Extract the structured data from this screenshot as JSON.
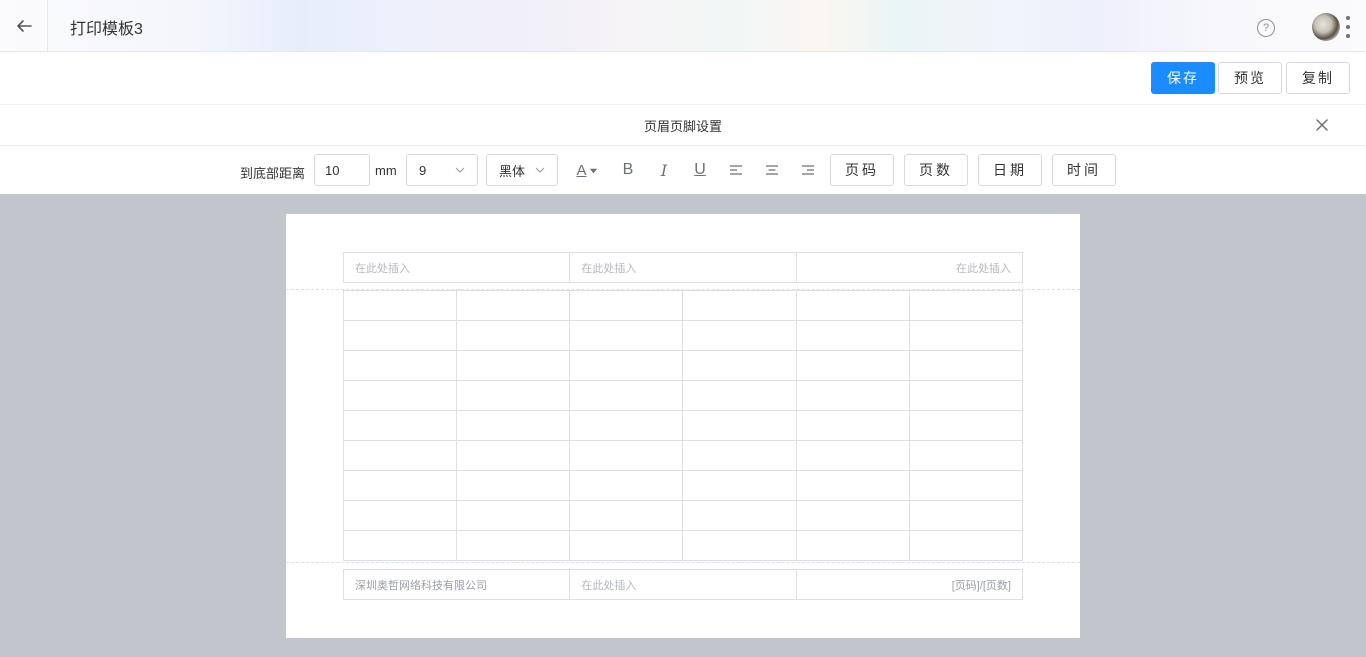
{
  "header": {
    "title": "打印模板3",
    "help_glyph": "?",
    "icons": [
      "arrow-left-icon",
      "help-circle-icon",
      "more-vertical-icon"
    ]
  },
  "actions": {
    "save": "保存",
    "preview": "预览",
    "copy": "复制",
    "primary_color": "#1a8cff"
  },
  "panel": {
    "title": "页眉页脚设置"
  },
  "toolbar": {
    "distance_label": "到底部距离",
    "distance_value": "10",
    "unit": "mm",
    "font_size": "9",
    "font_family": "黑体",
    "font_color_glyph": "A",
    "bold_glyph": "B",
    "italic_glyph": "I",
    "underline_glyph": "U",
    "page_number": "页码",
    "page_count": "页数",
    "date": "日期",
    "time": "时间"
  },
  "document": {
    "header_cells": [
      "在此处插入",
      "在此处插入",
      "在此处插入"
    ],
    "footer_cells": [
      "深圳奥哲网络科技有限公司",
      "在此处插入",
      "[页码]/[页数]"
    ],
    "table_rows": 9,
    "table_cols": 6
  }
}
